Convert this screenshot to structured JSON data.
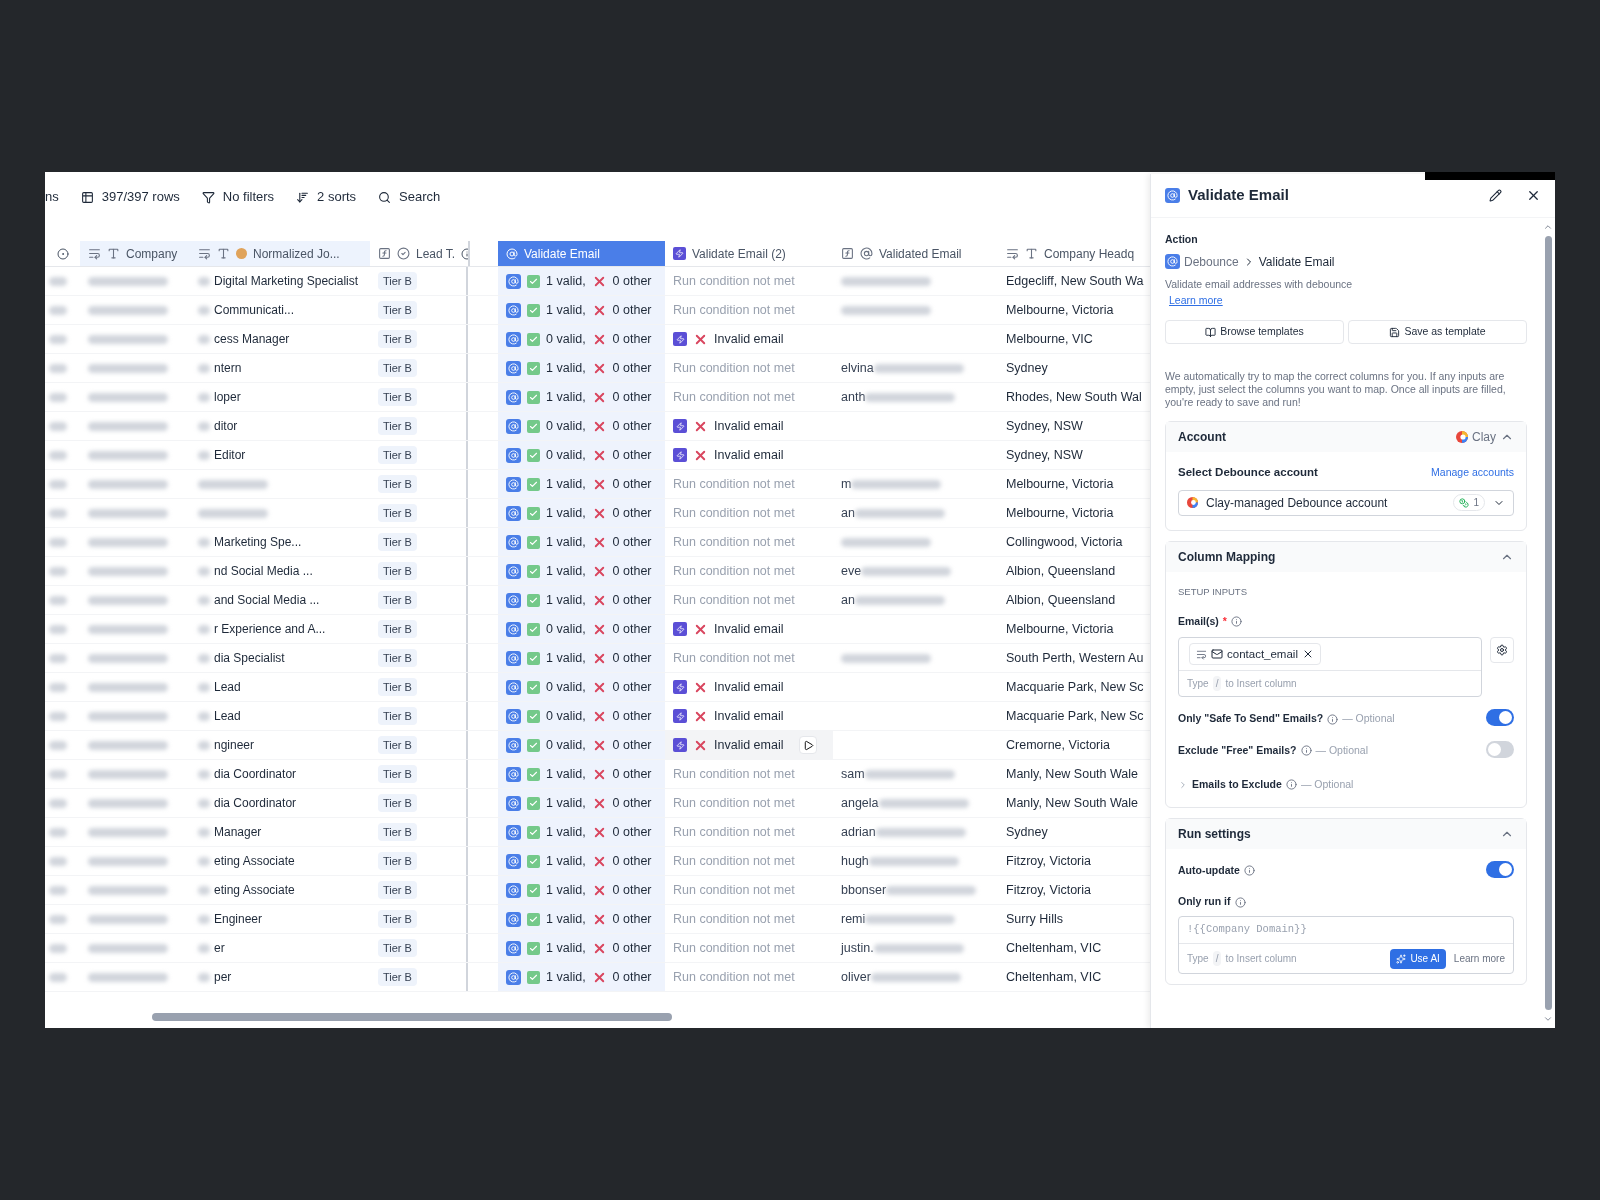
{
  "toolbar": {
    "columns_fragment": "ns",
    "rows": "397/397 rows",
    "filters": "No filters",
    "sorts": "2 sorts",
    "search": "Search"
  },
  "columns": [
    {
      "label": "Company",
      "selected": false
    },
    {
      "label": "Normalized Jo...",
      "selected": false
    },
    {
      "label": "Lead T.",
      "selected": false
    },
    {
      "label": "Validate Email",
      "selected": true
    },
    {
      "label": "Validate Email (2)",
      "selected": false
    },
    {
      "label": "Validated Email",
      "selected": false
    },
    {
      "label": "Company Headq",
      "selected": false
    }
  ],
  "rows": [
    {
      "job": "Digital Marketing Specialist",
      "tier": "Tier B",
      "valid": "1 valid,",
      "other": "0 other",
      "status": {
        "kind": "not_run",
        "text": "Run condition not met"
      },
      "email": "",
      "hq": "Edgecliff, New South Wa",
      "hovered": false
    },
    {
      "job": "Communicati...",
      "tier": "Tier B",
      "valid": "1 valid,",
      "other": "0 other",
      "status": {
        "kind": "not_run",
        "text": "Run condition not met"
      },
      "email": "",
      "hq": "Melbourne, Victoria",
      "hovered": false
    },
    {
      "job": "cess Manager",
      "tier": "Tier B",
      "valid": "0 valid,",
      "other": "0 other",
      "status": {
        "kind": "invalid",
        "text": "Invalid email"
      },
      "email": "",
      "hq": "Melbourne, VIC",
      "hovered": false
    },
    {
      "job": "ntern",
      "tier": "Tier B",
      "valid": "1 valid,",
      "other": "0 other",
      "status": {
        "kind": "not_run",
        "text": "Run condition not met"
      },
      "email": "elvina",
      "hq": "Sydney",
      "hovered": false
    },
    {
      "job": "loper",
      "tier": "Tier B",
      "valid": "1 valid,",
      "other": "0 other",
      "status": {
        "kind": "not_run",
        "text": "Run condition not met"
      },
      "email": "anth",
      "hq": "Rhodes, New South Wal",
      "hovered": false
    },
    {
      "job": "ditor",
      "tier": "Tier B",
      "valid": "0 valid,",
      "other": "0 other",
      "status": {
        "kind": "invalid",
        "text": "Invalid email"
      },
      "email": "",
      "hq": "Sydney, NSW",
      "hovered": false
    },
    {
      "job": "Editor",
      "tier": "Tier B",
      "valid": "0 valid,",
      "other": "0 other",
      "status": {
        "kind": "invalid",
        "text": "Invalid email"
      },
      "email": "",
      "hq": "Sydney, NSW",
      "hovered": false
    },
    {
      "job": "",
      "tier": "Tier B",
      "valid": "1 valid,",
      "other": "0 other",
      "status": {
        "kind": "not_run",
        "text": "Run condition not met"
      },
      "email": "m",
      "hq": "Melbourne, Victoria",
      "hovered": false
    },
    {
      "job": "",
      "tier": "Tier B",
      "valid": "1 valid,",
      "other": "0 other",
      "status": {
        "kind": "not_run",
        "text": "Run condition not met"
      },
      "email": "an",
      "hq": "Melbourne, Victoria",
      "hovered": false
    },
    {
      "job": "Marketing Spe...",
      "tier": "Tier B",
      "valid": "1 valid,",
      "other": "0 other",
      "status": {
        "kind": "not_run",
        "text": "Run condition not met"
      },
      "email": "",
      "hq": "Collingwood, Victoria",
      "hovered": false
    },
    {
      "job": "nd Social Media ...",
      "tier": "Tier B",
      "valid": "1 valid,",
      "other": "0 other",
      "status": {
        "kind": "not_run",
        "text": "Run condition not met"
      },
      "email": "eve",
      "hq": "Albion, Queensland",
      "hovered": false
    },
    {
      "job": "and Social Media ...",
      "tier": "Tier B",
      "valid": "1 valid,",
      "other": "0 other",
      "status": {
        "kind": "not_run",
        "text": "Run condition not met"
      },
      "email": "an",
      "hq": "Albion, Queensland",
      "hovered": false
    },
    {
      "job": "r Experience and A...",
      "tier": "Tier B",
      "valid": "0 valid,",
      "other": "0 other",
      "status": {
        "kind": "invalid",
        "text": "Invalid email"
      },
      "email": "",
      "hq": "Melbourne, Victoria",
      "hovered": false
    },
    {
      "job": "dia Specialist",
      "tier": "Tier B",
      "valid": "1 valid,",
      "other": "0 other",
      "status": {
        "kind": "not_run",
        "text": "Run condition not met"
      },
      "email": "",
      "hq": "South Perth, Western Au",
      "hovered": false
    },
    {
      "job": "Lead",
      "tier": "Tier B",
      "valid": "0 valid,",
      "other": "0 other",
      "status": {
        "kind": "invalid",
        "text": "Invalid email"
      },
      "email": "",
      "hq": "Macquarie Park, New Sc",
      "hovered": false
    },
    {
      "job": "Lead",
      "tier": "Tier B",
      "valid": "0 valid,",
      "other": "0 other",
      "status": {
        "kind": "invalid",
        "text": "Invalid email"
      },
      "email": "",
      "hq": "Macquarie Park, New Sc",
      "hovered": false
    },
    {
      "job": "ngineer",
      "tier": "Tier B",
      "valid": "0 valid,",
      "other": "0 other",
      "status": {
        "kind": "invalid",
        "text": "Invalid email"
      },
      "email": "",
      "hq": "Cremorne, Victoria",
      "hovered": true
    },
    {
      "job": "dia Coordinator",
      "tier": "Tier B",
      "valid": "1 valid,",
      "other": "0 other",
      "status": {
        "kind": "not_run",
        "text": "Run condition not met"
      },
      "email": "sam",
      "hq": "Manly, New South Wale",
      "hovered": false
    },
    {
      "job": "dia Coordinator",
      "tier": "Tier B",
      "valid": "1 valid,",
      "other": "0 other",
      "status": {
        "kind": "not_run",
        "text": "Run condition not met"
      },
      "email": "angela",
      "hq": "Manly, New South Wale",
      "hovered": false
    },
    {
      "job": "Manager",
      "tier": "Tier B",
      "valid": "1 valid,",
      "other": "0 other",
      "status": {
        "kind": "not_run",
        "text": "Run condition not met"
      },
      "email": "adrian",
      "hq": "Sydney",
      "hovered": false
    },
    {
      "job": "eting Associate",
      "tier": "Tier B",
      "valid": "1 valid,",
      "other": "0 other",
      "status": {
        "kind": "not_run",
        "text": "Run condition not met"
      },
      "email": "hugh",
      "hq": "Fitzroy, Victoria",
      "hovered": false
    },
    {
      "job": "eting Associate",
      "tier": "Tier B",
      "valid": "1 valid,",
      "other": "0 other",
      "status": {
        "kind": "not_run",
        "text": "Run condition not met"
      },
      "email": "bbonser",
      "hq": "Fitzroy, Victoria",
      "hovered": false
    },
    {
      "job": "Engineer",
      "tier": "Tier B",
      "valid": "1 valid,",
      "other": "0 other",
      "status": {
        "kind": "not_run",
        "text": "Run condition not met"
      },
      "email": "remi",
      "hq": "Surry Hills",
      "hovered": false
    },
    {
      "job": "er",
      "tier": "Tier B",
      "valid": "1 valid,",
      "other": "0 other",
      "status": {
        "kind": "not_run",
        "text": "Run condition not met"
      },
      "email": "justin.",
      "hq": "Cheltenham, VIC",
      "hovered": false
    },
    {
      "job": "per",
      "tier": "Tier B",
      "valid": "1 valid,",
      "other": "0 other",
      "status": {
        "kind": "not_run",
        "text": "Run condition not met"
      },
      "email": "oliver",
      "hq": "Cheltenham, VIC",
      "hovered": false
    }
  ],
  "panel": {
    "title": "Validate Email",
    "action_label": "Action",
    "breadcrumb": [
      "Debounce",
      "Validate Email"
    ],
    "description": "Validate email addresses with debounce",
    "learn_more": "Learn more",
    "buttons": [
      "Browse templates",
      "Save as template"
    ],
    "intro": "We automatically try to map the correct columns for you. If any inputs are empty, just select the columns you want to map. Once all inputs are filled, you're ready to save and run!",
    "account": {
      "title": "Account",
      "provider": "Clay",
      "expanded": true,
      "select_label": "Select Debounce account",
      "manage": "Manage accounts",
      "value": "Clay-managed Debounce account",
      "count": "1"
    },
    "mapping": {
      "title": "Column Mapping",
      "expanded": true,
      "setup": "SETUP INPUTS",
      "emails_label": "Email(s)",
      "required": "*",
      "chip": "contact_email",
      "hint": [
        "Type",
        "/",
        "to Insert column"
      ],
      "toggles": [
        {
          "label": "Only \"Safe To Send\" Emails?",
          "optional": "— Optional",
          "on": true
        },
        {
          "label": "Exclude \"Free\" Emails?",
          "optional": "— Optional",
          "on": false
        }
      ],
      "exclude": {
        "label": "Emails to Exclude",
        "optional": "— Optional",
        "expanded": false
      }
    },
    "run": {
      "title": "Run settings",
      "expanded": true,
      "auto_update": {
        "label": "Auto-update",
        "on": true
      },
      "only_run_if": "Only run if",
      "formula": "!{{Company Domain}}",
      "hint": [
        "Type",
        "/",
        "to Insert column"
      ],
      "use_ai": "Use AI",
      "learn_more": "Learn more"
    }
  }
}
